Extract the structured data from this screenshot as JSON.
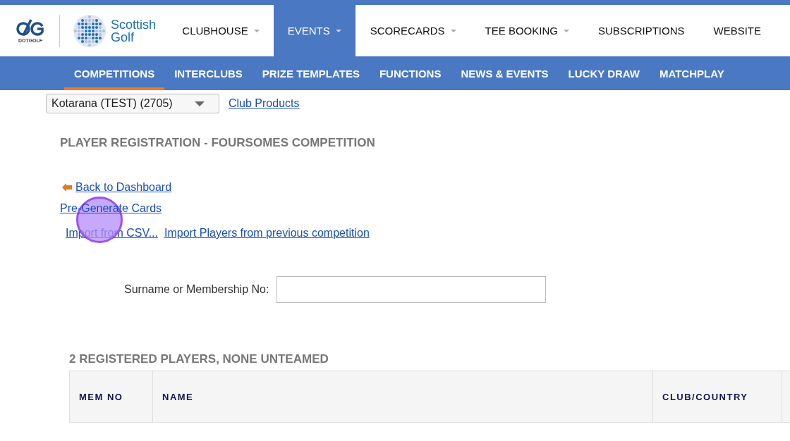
{
  "header": {
    "logos": [
      {
        "kind": "dotgolf",
        "text": "DOTGOLF"
      },
      {
        "kind": "scottish",
        "line1": "Scottish",
        "line2": "Golf"
      }
    ],
    "nav": [
      {
        "label": "CLUBHOUSE",
        "dropdown": true,
        "selected": false
      },
      {
        "label": "EVENTS",
        "dropdown": true,
        "selected": true
      },
      {
        "label": "SCORECARDS",
        "dropdown": true,
        "selected": false
      },
      {
        "label": "TEE BOOKING",
        "dropdown": true,
        "selected": false
      },
      {
        "label": "SUBSCRIPTIONS",
        "dropdown": false,
        "selected": false
      },
      {
        "label": "WEBSITE",
        "dropdown": false,
        "selected": false
      }
    ]
  },
  "subnav": [
    {
      "label": "COMPETITIONS",
      "selected": true
    },
    {
      "label": "INTERCLUBS",
      "selected": false
    },
    {
      "label": "PRIZE TEMPLATES",
      "selected": false
    },
    {
      "label": "FUNCTIONS",
      "selected": false
    },
    {
      "label": "NEWS & EVENTS",
      "selected": false
    },
    {
      "label": "LUCKY DRAW",
      "selected": false
    },
    {
      "label": "MATCHPLAY",
      "selected": false
    }
  ],
  "club_select": {
    "value": "Kotarana (TEST) (2705)"
  },
  "club_products_link": "Club Products",
  "page_title": "PLAYER REGISTRATION - FOURSOMES COMPETITION",
  "back_link": "Back to Dashboard",
  "pregenerate_link": "Pre-Generate Cards",
  "import_links": [
    "Import from CSV...",
    "Import Players from previous competition"
  ],
  "search": {
    "label": "Surname or Membership No:"
  },
  "players_heading": "2 REGISTERED PLAYERS, NONE UNTEAMED",
  "table": {
    "columns": [
      "MEM NO",
      "NAME",
      "CLUB/COUNTRY"
    ]
  }
}
